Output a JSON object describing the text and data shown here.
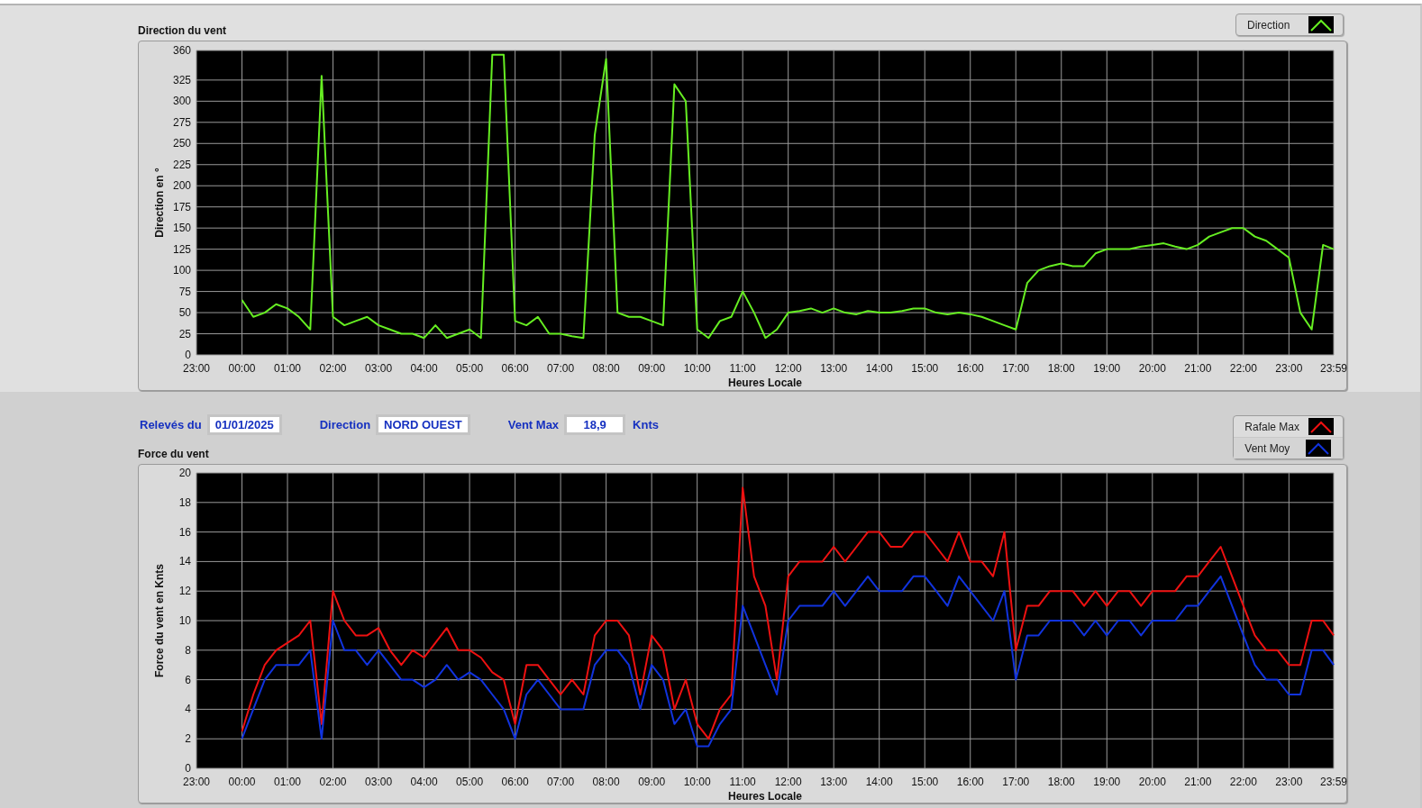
{
  "panels": [
    {
      "title": "Direction du vent",
      "x_axis_start_label": "23:00",
      "chart_data": {
        "type": "line",
        "xlabel": "Heures Locale",
        "ylabel": "Direction en °",
        "xlim": [
          -1,
          23.983
        ],
        "ylim": [
          0,
          360
        ],
        "grid": true,
        "xticks": [
          {
            "value": 0,
            "label": "00:00"
          },
          {
            "value": 1,
            "label": "01:00"
          },
          {
            "value": 2,
            "label": "02:00"
          },
          {
            "value": 3,
            "label": "03:00"
          },
          {
            "value": 4,
            "label": "04:00"
          },
          {
            "value": 5,
            "label": "05:00"
          },
          {
            "value": 6,
            "label": "06:00"
          },
          {
            "value": 7,
            "label": "07:00"
          },
          {
            "value": 8,
            "label": "08:00"
          },
          {
            "value": 9,
            "label": "09:00"
          },
          {
            "value": 10,
            "label": "10:00"
          },
          {
            "value": 11,
            "label": "11:00"
          },
          {
            "value": 12,
            "label": "12:00"
          },
          {
            "value": 13,
            "label": "13:00"
          },
          {
            "value": 14,
            "label": "14:00"
          },
          {
            "value": 15,
            "label": "15:00"
          },
          {
            "value": 16,
            "label": "16:00"
          },
          {
            "value": 17,
            "label": "17:00"
          },
          {
            "value": 18,
            "label": "18:00"
          },
          {
            "value": 19,
            "label": "19:00"
          },
          {
            "value": 20,
            "label": "20:00"
          },
          {
            "value": 21,
            "label": "21:00"
          },
          {
            "value": 22,
            "label": "22:00"
          },
          {
            "value": 23,
            "label": "23:00"
          },
          {
            "value": 23.983,
            "label": "23:59"
          }
        ],
        "yticks": [
          0,
          25,
          50,
          75,
          100,
          125,
          150,
          175,
          200,
          225,
          250,
          275,
          300,
          325,
          360
        ],
        "x": [
          0,
          0.25,
          0.5,
          0.75,
          1,
          1.25,
          1.5,
          1.75,
          2,
          2.25,
          2.5,
          2.75,
          3,
          3.25,
          3.5,
          3.75,
          4,
          4.25,
          4.5,
          4.75,
          5,
          5.25,
          5.5,
          5.75,
          6,
          6.25,
          6.5,
          6.75,
          7,
          7.25,
          7.5,
          7.75,
          8,
          8.25,
          8.5,
          8.75,
          9,
          9.25,
          9.5,
          9.75,
          10,
          10.25,
          10.5,
          10.75,
          11,
          11.25,
          11.5,
          11.75,
          12,
          12.25,
          12.5,
          12.75,
          13,
          13.25,
          13.5,
          13.75,
          14,
          14.25,
          14.5,
          14.75,
          15,
          15.25,
          15.5,
          15.75,
          16,
          16.25,
          16.5,
          16.75,
          17,
          17.25,
          17.5,
          17.75,
          18,
          18.25,
          18.5,
          18.75,
          19,
          19.25,
          19.5,
          19.75,
          20,
          20.25,
          20.5,
          20.75,
          21,
          21.25,
          21.5,
          21.75,
          22,
          22.25,
          22.5,
          22.75,
          23,
          23.25,
          23.5,
          23.75,
          23.983
        ],
        "series": [
          {
            "name": "Direction",
            "color": "#66ee22",
            "values": [
              65,
              45,
              50,
              60,
              55,
              45,
              30,
              330,
              45,
              35,
              40,
              45,
              35,
              30,
              25,
              25,
              20,
              35,
              20,
              25,
              30,
              20,
              355,
              355,
              40,
              35,
              45,
              25,
              25,
              22,
              20,
              260,
              350,
              50,
              45,
              45,
              40,
              35,
              320,
              300,
              30,
              20,
              40,
              45,
              75,
              50,
              20,
              30,
              50,
              52,
              55,
              50,
              55,
              50,
              48,
              52,
              50,
              50,
              52,
              55,
              55,
              50,
              48,
              50,
              48,
              45,
              40,
              35,
              30,
              85,
              100,
              105,
              108,
              105,
              105,
              120,
              125,
              125,
              125,
              128,
              130,
              132,
              128,
              125,
              130,
              140,
              145,
              150,
              150,
              140,
              135,
              125,
              115,
              50,
              30,
              130,
              125
            ]
          }
        ]
      }
    },
    {
      "title": "Force du vent",
      "x_axis_start_label": "23:00",
      "chart_data": {
        "type": "line",
        "xlabel": "Heures Locale",
        "ylabel": "Force du vent en Knts",
        "xlim": [
          -1,
          23.983
        ],
        "ylim": [
          0,
          20
        ],
        "grid": true,
        "xticks": [
          {
            "value": 0,
            "label": "00:00"
          },
          {
            "value": 1,
            "label": "01:00"
          },
          {
            "value": 2,
            "label": "02:00"
          },
          {
            "value": 3,
            "label": "03:00"
          },
          {
            "value": 4,
            "label": "04:00"
          },
          {
            "value": 5,
            "label": "05:00"
          },
          {
            "value": 6,
            "label": "06:00"
          },
          {
            "value": 7,
            "label": "07:00"
          },
          {
            "value": 8,
            "label": "08:00"
          },
          {
            "value": 9,
            "label": "09:00"
          },
          {
            "value": 10,
            "label": "10:00"
          },
          {
            "value": 11,
            "label": "11:00"
          },
          {
            "value": 12,
            "label": "12:00"
          },
          {
            "value": 13,
            "label": "13:00"
          },
          {
            "value": 14,
            "label": "14:00"
          },
          {
            "value": 15,
            "label": "15:00"
          },
          {
            "value": 16,
            "label": "16:00"
          },
          {
            "value": 17,
            "label": "17:00"
          },
          {
            "value": 18,
            "label": "18:00"
          },
          {
            "value": 19,
            "label": "19:00"
          },
          {
            "value": 20,
            "label": "20:00"
          },
          {
            "value": 21,
            "label": "21:00"
          },
          {
            "value": 22,
            "label": "22:00"
          },
          {
            "value": 23,
            "label": "23:00"
          },
          {
            "value": 23.983,
            "label": "23:59"
          }
        ],
        "yticks": [
          0,
          2,
          4,
          6,
          8,
          10,
          12,
          14,
          16,
          18,
          20
        ],
        "x": [
          0,
          0.25,
          0.5,
          0.75,
          1,
          1.25,
          1.5,
          1.75,
          2,
          2.25,
          2.5,
          2.75,
          3,
          3.25,
          3.5,
          3.75,
          4,
          4.25,
          4.5,
          4.75,
          5,
          5.25,
          5.5,
          5.75,
          6,
          6.25,
          6.5,
          6.75,
          7,
          7.25,
          7.5,
          7.75,
          8,
          8.25,
          8.5,
          8.75,
          9,
          9.25,
          9.5,
          9.75,
          10,
          10.25,
          10.5,
          10.75,
          11,
          11.25,
          11.5,
          11.75,
          12,
          12.25,
          12.5,
          12.75,
          13,
          13.25,
          13.5,
          13.75,
          14,
          14.25,
          14.5,
          14.75,
          15,
          15.25,
          15.5,
          15.75,
          16,
          16.25,
          16.5,
          16.75,
          17,
          17.25,
          17.5,
          17.75,
          18,
          18.25,
          18.5,
          18.75,
          19,
          19.25,
          19.5,
          19.75,
          20,
          20.25,
          20.5,
          20.75,
          21,
          21.25,
          21.5,
          21.75,
          22,
          22.25,
          22.5,
          22.75,
          23,
          23.25,
          23.5,
          23.75,
          23.983
        ],
        "series": [
          {
            "name": "Rafale Max",
            "color": "#ee1111",
            "values": [
              2.5,
              5,
              7,
              8,
              8.5,
              9,
              10,
              3,
              12,
              10,
              9,
              9,
              9.5,
              8,
              7,
              8,
              7.5,
              8.5,
              9.5,
              8,
              8,
              7.5,
              6.5,
              6,
              3,
              7,
              7,
              6,
              5,
              6,
              5,
              9,
              10,
              10,
              9,
              5,
              9,
              8,
              4,
              6,
              3,
              2,
              4,
              5,
              19,
              13,
              11,
              6,
              13,
              14,
              14,
              14,
              15,
              14,
              15,
              16,
              16,
              15,
              15,
              16,
              16,
              15,
              14,
              16,
              14,
              14,
              13,
              16,
              8,
              11,
              11,
              12,
              12,
              12,
              11,
              12,
              11,
              12,
              12,
              11,
              12,
              12,
              12,
              13,
              13,
              14,
              15,
              13,
              11,
              9,
              8,
              8,
              7,
              7,
              10,
              10,
              9
            ]
          },
          {
            "name": "Vent Moy",
            "color": "#1133dd",
            "values": [
              2,
              4,
              6,
              7,
              7,
              7,
              8,
              2,
              10,
              8,
              8,
              7,
              8,
              7,
              6,
              6,
              5.5,
              6,
              7,
              6,
              6.5,
              6,
              5,
              4,
              2,
              5,
              6,
              5,
              4,
              4,
              4,
              7,
              8,
              8,
              7,
              4,
              7,
              6,
              3,
              4,
              1.5,
              1.5,
              3,
              4,
              11,
              9,
              7,
              5,
              10,
              11,
              11,
              11,
              12,
              11,
              12,
              13,
              12,
              12,
              12,
              13,
              13,
              12,
              11,
              13,
              12,
              11,
              10,
              12,
              6,
              9,
              9,
              10,
              10,
              10,
              9,
              10,
              9,
              10,
              10,
              9,
              10,
              10,
              10,
              11,
              11,
              12,
              13,
              11,
              9,
              7,
              6,
              6,
              5,
              5,
              8,
              8,
              7
            ]
          }
        ]
      }
    }
  ],
  "info_bar": [
    {
      "label": "Relevés du",
      "value": "01/01/2025"
    },
    {
      "label": "Direction",
      "value": "NORD OUEST"
    },
    {
      "label": "Vent Max",
      "value": "18,9",
      "unit": "Knts"
    }
  ]
}
